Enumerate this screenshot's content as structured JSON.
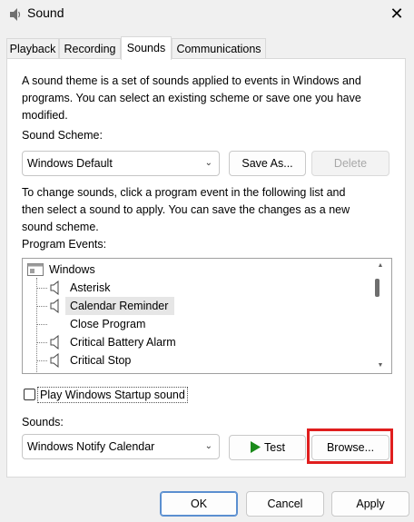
{
  "window": {
    "title": "Sound"
  },
  "tabs": [
    {
      "label": "Playback",
      "active": false
    },
    {
      "label": "Recording",
      "active": false
    },
    {
      "label": "Sounds",
      "active": true
    },
    {
      "label": "Communications",
      "active": false
    }
  ],
  "sounds_tab": {
    "intro_line1": "A sound theme is a set of sounds applied to events in Windows and",
    "intro_line2": "programs.  You can select an existing scheme or save one you have",
    "intro_line3": "modified.",
    "scheme_label": "Sound Scheme:",
    "scheme_value": "Windows Default",
    "save_as_label": "Save As...",
    "delete_label": "Delete",
    "change_line1": "To change sounds, click a program event in the following list and",
    "change_line2": "then select a sound to apply.  You can save the changes as a new",
    "change_line3": "sound scheme.",
    "program_events_label": "Program Events:",
    "events": {
      "root": "Windows",
      "items": [
        {
          "label": "Asterisk",
          "has_sound": true
        },
        {
          "label": "Calendar Reminder",
          "has_sound": true,
          "selected": true
        },
        {
          "label": "Close Program",
          "has_sound": false
        },
        {
          "label": "Critical Battery Alarm",
          "has_sound": true
        },
        {
          "label": "Critical Stop",
          "has_sound": true
        }
      ]
    },
    "startup_checkbox_label": "Play Windows Startup sound",
    "startup_checked": false,
    "sounds_label": "Sounds:",
    "sounds_value": "Windows Notify Calendar",
    "test_label": "Test",
    "browse_label": "Browse..."
  },
  "footer": {
    "ok_label": "OK",
    "cancel_label": "Cancel",
    "apply_label": "Apply"
  },
  "colors": {
    "highlight_border": "#e01e1e",
    "play_icon": "#1a8a1a",
    "default_button_border": "#5b8fd0"
  },
  "icons": {
    "app": "speaker-icon",
    "close": "close-icon",
    "tree_root": "windows-folder-icon",
    "event_sound": "speaker-icon",
    "dropdown": "chevron-down-icon",
    "test": "play-icon"
  }
}
